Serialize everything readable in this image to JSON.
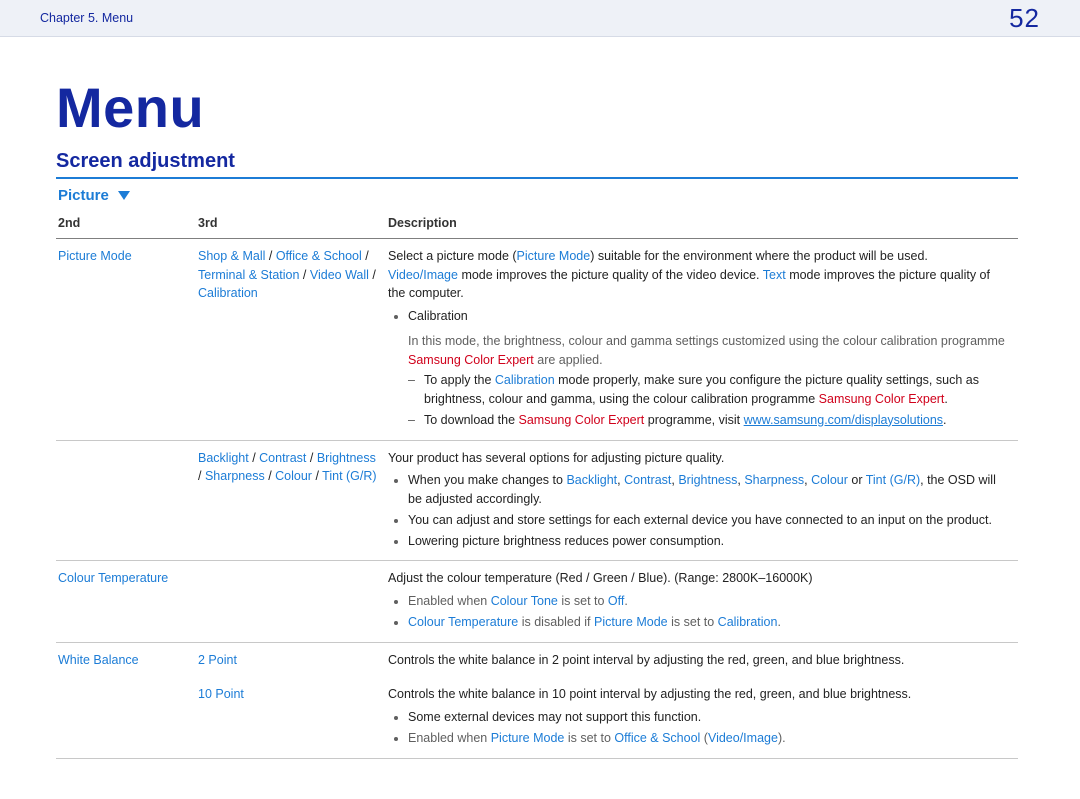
{
  "header": {
    "chapter_label": "Chapter 5. Menu",
    "page_number": "52"
  },
  "title": "Menu",
  "section": "Screen adjustment",
  "category": "Picture",
  "columns": {
    "c1": "2nd",
    "c2": "3rd",
    "c3": "Description"
  },
  "row1": {
    "col1": "Picture Mode",
    "col2": {
      "a": "Shop & Mall",
      "sep": " / ",
      "b": "Office & School",
      "c": "Terminal & Station",
      "d": "Video Wall",
      "e": "Calibration"
    },
    "desc": {
      "lead_a": "Select a picture mode (",
      "pm": "Picture Mode",
      "lead_b": ") suitable for the environment where the product will be used.",
      "vi": "Video/Image",
      "vi_tail": " mode improves the picture quality of the video device. ",
      "text": "Text",
      "text_tail": " mode improves the picture quality of the computer.",
      "calib_head": "Calibration",
      "calib_body_a": "In this mode, the brightness, colour and gamma settings customized using the colour calibration programme ",
      "sce": "Samsung Color Expert",
      "calib_body_b": " are applied.",
      "dash1_a": "To apply the ",
      "dash1_b": "Calibration",
      "dash1_c": " mode properly, make sure you configure the picture quality settings, such as brightness, colour and gamma, using the colour calibration programme ",
      "dash1_d": "Samsung Color Expert",
      "dash1_e": ".",
      "dash2_a": "To download the ",
      "dash2_b": "Samsung Color Expert",
      "dash2_c": " programme, visit ",
      "dash2_url": "www.samsung.com/displaysolutions",
      "dash2_d": "."
    }
  },
  "row2": {
    "col2": {
      "a": "Backlight",
      "b": "Contrast",
      "c": "Brightness",
      "d": "Sharpness",
      "e": "Colour",
      "f": "Tint (G/R)",
      "sep": " / "
    },
    "desc": {
      "lead": "Your product has several options for adjusting picture quality.",
      "b1_a": "When you make changes to ",
      "b1_bk": "Backlight",
      "b1_sep1": ", ",
      "b1_ct": "Contrast",
      "b1_sep2": ", ",
      "b1_br": "Brightness",
      "b1_sep3": ", ",
      "b1_sh": "Sharpness",
      "b1_sep4": ", ",
      "b1_co": "Colour",
      "b1_or": " or ",
      "b1_ti": "Tint (G/R)",
      "b1_tail": ", the OSD will be adjusted accordingly.",
      "b2": "You can adjust and store settings for each external device you have connected to an input on the product.",
      "b3": "Lowering picture brightness reduces power consumption."
    }
  },
  "row3": {
    "col1": "Colour Temperature",
    "desc": {
      "lead": "Adjust the colour temperature (Red / Green / Blue). (Range: 2800K–16000K)",
      "b1_a": "Enabled when ",
      "b1_b": "Colour Tone",
      "b1_c": " is set to ",
      "b1_d": "Off",
      "b1_e": ".",
      "b2_a": "Colour Temperature",
      "b2_b": " is disabled if ",
      "b2_c": "Picture Mode",
      "b2_d": " is set to ",
      "b2_e": "Calibration",
      "b2_f": "."
    }
  },
  "row4": {
    "col1": "White Balance",
    "col2": "2 Point",
    "desc": "Controls the white balance in 2 point interval by adjusting the red, green, and blue brightness."
  },
  "row5": {
    "col2": "10 Point",
    "desc": {
      "lead": "Controls the white balance in 10 point interval by adjusting the red, green, and blue brightness.",
      "b1": "Some external devices may not support this function.",
      "b2_a": "Enabled when ",
      "b2_b": "Picture Mode",
      "b2_c": " is set to ",
      "b2_d": "Office & School",
      "b2_e": " (",
      "b2_f": "Video/Image",
      "b2_g": ")."
    }
  }
}
